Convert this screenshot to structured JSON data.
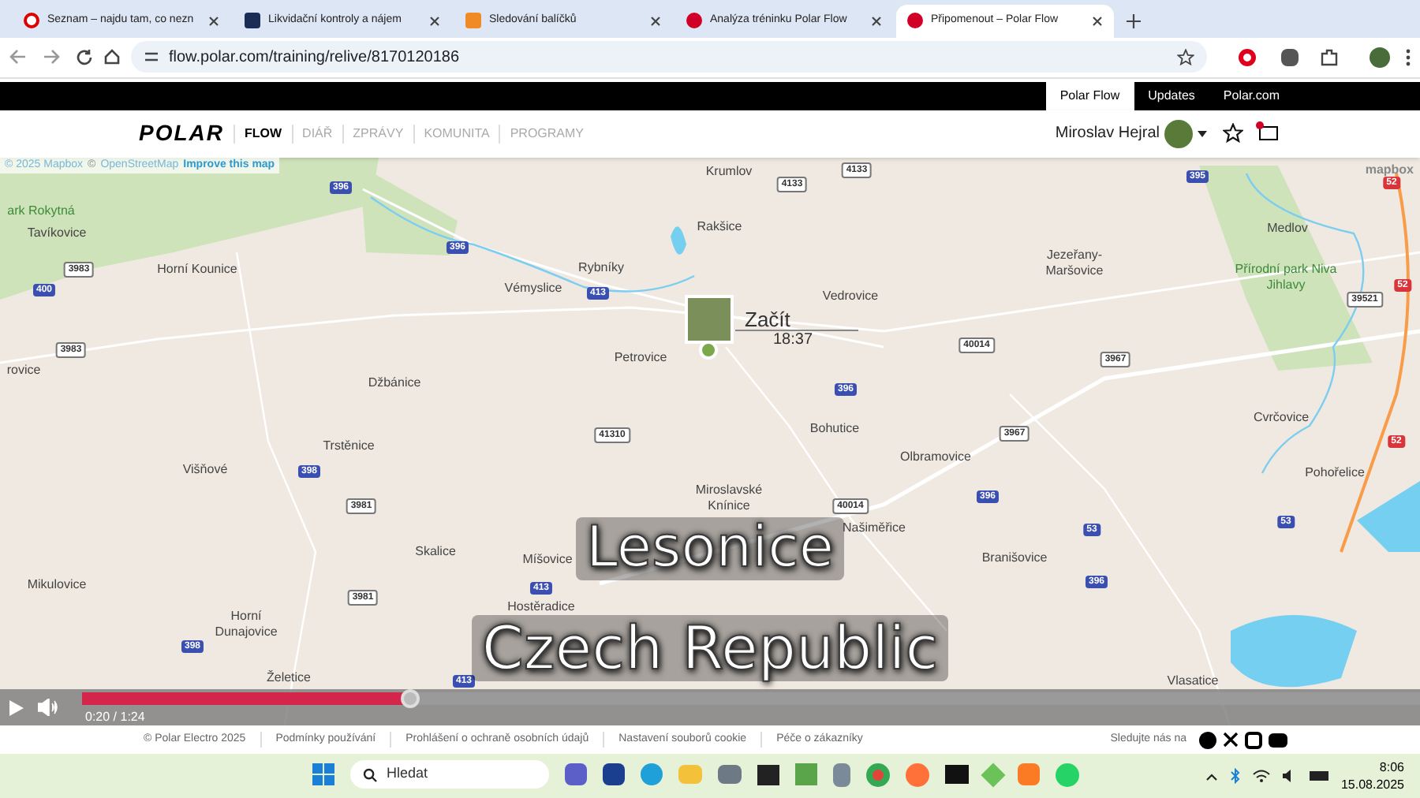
{
  "browser": {
    "tabs": [
      {
        "title": "Seznam – najdu tam, co nezn",
        "selected": false,
        "kind": "seznam"
      },
      {
        "title": "Likvidační kontroly a nájem",
        "selected": false,
        "kind": "sz"
      },
      {
        "title": "Sledování balíčků",
        "selected": false,
        "kind": "parcel"
      },
      {
        "title": "Analýza tréninku Polar Flow",
        "selected": false,
        "kind": "polar"
      },
      {
        "title": "Připomenout – Polar Flow",
        "selected": true,
        "kind": "polar"
      }
    ],
    "url": "flow.polar.com/training/relive/8170120186"
  },
  "site_header": {
    "top_links": [
      {
        "label": "Polar Flow",
        "selected": true
      },
      {
        "label": "Updates",
        "selected": false
      },
      {
        "label": "Polar.com",
        "selected": false
      }
    ],
    "logo": "POLAR",
    "nav": [
      {
        "label": "FLOW",
        "selected": true
      },
      {
        "label": "DIÁŘ",
        "selected": false
      },
      {
        "label": "ZPRÁVY",
        "selected": false
      },
      {
        "label": "KOMUNITA",
        "selected": false
      },
      {
        "label": "PROGRAMY",
        "selected": false
      }
    ],
    "user_name": "Miroslav Hejral"
  },
  "map": {
    "attribution": [
      "© 2025 Mapbox",
      "©",
      "OpenStreetMap",
      "Improve this map"
    ],
    "brand": "mapbox",
    "places": [
      {
        "name": "Krumlov",
        "kind": "town"
      },
      {
        "name": "Rakšice",
        "kind": "town"
      },
      {
        "name": "Rybníky",
        "kind": "town"
      },
      {
        "name": "Vémyslice",
        "kind": "town"
      },
      {
        "name": "Horní Kounice",
        "kind": "town"
      },
      {
        "name": "ark Rokytná",
        "kind": "park"
      },
      {
        "name": "Tavíkovice",
        "kind": "town"
      },
      {
        "name": "Petrovice",
        "kind": "town"
      },
      {
        "name": "Džbánice",
        "kind": "town"
      },
      {
        "name": "rovice",
        "kind": "town"
      },
      {
        "name": "Vedrovice",
        "kind": "town"
      },
      {
        "name": "Jezeřany-Maršovice",
        "kind": "town"
      },
      {
        "name": "Medlov",
        "kind": "town"
      },
      {
        "name": "Přírodní park Niva Jihlavy",
        "kind": "park"
      },
      {
        "name": "Cvrčovice",
        "kind": "town"
      },
      {
        "name": "Bohutice",
        "kind": "town"
      },
      {
        "name": "Trstěnice",
        "kind": "town"
      },
      {
        "name": "Višňové",
        "kind": "town"
      },
      {
        "name": "Olbramovice",
        "kind": "town"
      },
      {
        "name": "Miroslavské Knínice",
        "kind": "town"
      },
      {
        "name": "Našiměřice",
        "kind": "town"
      },
      {
        "name": "Pohořelice",
        "kind": "town"
      },
      {
        "name": "Skalice",
        "kind": "town"
      },
      {
        "name": "Míšovice",
        "kind": "town"
      },
      {
        "name": "Branišovice",
        "kind": "town"
      },
      {
        "name": "Mikulovice",
        "kind": "town"
      },
      {
        "name": "Horní Dunajovice",
        "kind": "town"
      },
      {
        "name": "Hostěradice",
        "kind": "town"
      },
      {
        "name": "Vlasatice",
        "kind": "town"
      },
      {
        "name": "Želetice",
        "kind": "town"
      }
    ],
    "road_shields": [
      {
        "label": "4133",
        "kind": "local"
      },
      {
        "label": "4133",
        "kind": "local"
      },
      {
        "label": "396",
        "kind": "regional"
      },
      {
        "label": "396",
        "kind": "regional"
      },
      {
        "label": "395",
        "kind": "regional"
      },
      {
        "label": "52",
        "kind": "motorway"
      },
      {
        "label": "52",
        "kind": "motorway"
      },
      {
        "label": "3983",
        "kind": "local"
      },
      {
        "label": "400",
        "kind": "regional"
      },
      {
        "label": "3983",
        "kind": "local"
      },
      {
        "label": "413",
        "kind": "regional"
      },
      {
        "label": "39521",
        "kind": "local"
      },
      {
        "label": "40014",
        "kind": "local"
      },
      {
        "label": "3967",
        "kind": "local"
      },
      {
        "label": "396",
        "kind": "regional"
      },
      {
        "label": "3967",
        "kind": "local"
      },
      {
        "label": "41310",
        "kind": "local"
      },
      {
        "label": "398",
        "kind": "regional"
      },
      {
        "label": "3981",
        "kind": "local"
      },
      {
        "label": "3981",
        "kind": "local"
      },
      {
        "label": "396",
        "kind": "regional"
      },
      {
        "label": "40014",
        "kind": "local"
      },
      {
        "label": "53",
        "kind": "regional"
      },
      {
        "label": "53",
        "kind": "regional"
      },
      {
        "label": "52",
        "kind": "motorway"
      },
      {
        "label": "413",
        "kind": "regional"
      },
      {
        "label": "396",
        "kind": "regional"
      },
      {
        "label": "398",
        "kind": "regional"
      },
      {
        "label": "413",
        "kind": "regional"
      }
    ],
    "marker": {
      "label": "Začít",
      "time": "18:37"
    },
    "overlay": {
      "place": "Lesonice",
      "country": "Czech Republic"
    }
  },
  "player": {
    "level": 0.245,
    "time": "0:20 / 1:24"
  },
  "footer": {
    "links": [
      "© Polar Electro 2025",
      "Podmínky používání",
      "Prohlášení o ochraně osobních údajů",
      "Nastavení souborů cookie",
      "Péče o zákazníky"
    ],
    "follow_label": "Sledujte nás na"
  },
  "taskbar": {
    "search_placeholder": "Hledat",
    "time": "8:06",
    "date": "15.08.2025"
  }
}
